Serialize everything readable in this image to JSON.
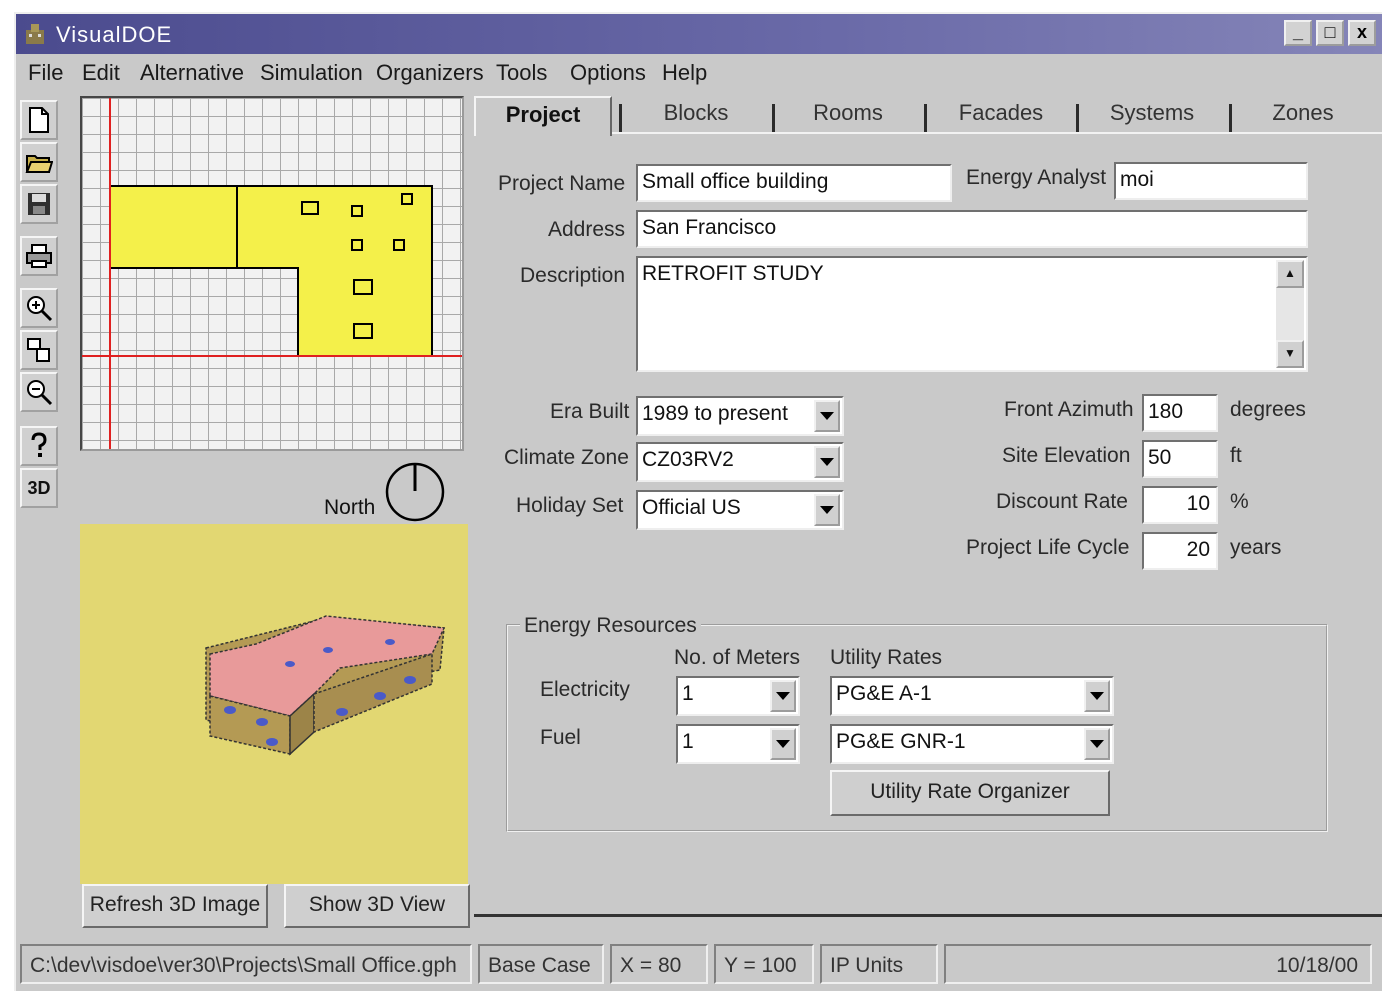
{
  "window": {
    "title": "VisualDOE",
    "minimize": "_",
    "maximize": "□",
    "close": "x"
  },
  "menu": [
    "File",
    "Edit",
    "Alternative",
    "Simulation",
    "Organizers",
    "Tools",
    "Options",
    "Help"
  ],
  "toolbar": {
    "icons": [
      "new-file-icon",
      "open-folder-icon",
      "save-disk-icon",
      "print-icon",
      "zoom-in-icon",
      "fit-view-icon",
      "zoom-out-icon",
      "help-icon",
      "3d-icon"
    ],
    "three_d_label": "3D"
  },
  "left_panel": {
    "north_label": "North",
    "refresh_button": "Refresh 3D Image",
    "show_button": "Show 3D View"
  },
  "tabs": [
    "Project",
    "Blocks",
    "Rooms",
    "Facades",
    "Systems",
    "Zones"
  ],
  "active_tab": "Project",
  "project": {
    "name_label": "Project Name",
    "name_value": "Small office building",
    "analyst_label": "Energy Analyst",
    "analyst_value": "moi",
    "address_label": "Address",
    "address_value": "San Francisco",
    "description_label": "Description",
    "description_value": "RETROFIT STUDY",
    "era_label": "Era Built",
    "era_value": "1989 to present",
    "climate_label": "Climate Zone",
    "climate_value": "CZ03RV2",
    "holiday_label": "Holiday Set",
    "holiday_value": "Official US",
    "azimuth_label": "Front Azimuth",
    "azimuth_value": "180",
    "azimuth_unit": "degrees",
    "elevation_label": "Site Elevation",
    "elevation_value": "50",
    "elevation_unit": "ft",
    "discount_label": "Discount Rate",
    "discount_value": "10",
    "discount_unit": "%",
    "lifecycle_label": "Project Life Cycle",
    "lifecycle_value": "20",
    "lifecycle_unit": "years"
  },
  "energy": {
    "title": "Energy Resources",
    "meters_header": "No. of Meters",
    "rates_header": "Utility Rates",
    "electricity_label": "Electricity",
    "electricity_meters": "1",
    "electricity_rate": "PG&E A-1",
    "fuel_label": "Fuel",
    "fuel_meters": "1",
    "fuel_rate": "PG&E GNR-1",
    "organizer_button": "Utility Rate Organizer"
  },
  "status": {
    "path": "C:\\dev\\visdoe\\ver30\\Projects\\Small Office.gph",
    "alternative": "Base Case",
    "x": "X = 80",
    "y": "Y = 100",
    "units": "IP Units",
    "date": "10/18/00"
  },
  "colors": {
    "window_bg": "#c9c9c9",
    "titlebar": "#5a5a9c",
    "plan_fill": "#f4f04a",
    "view_bg": "#e2d772",
    "roof": "#e89a9a",
    "wall": "#b49a54",
    "window_glass": "#4a5ac8"
  }
}
